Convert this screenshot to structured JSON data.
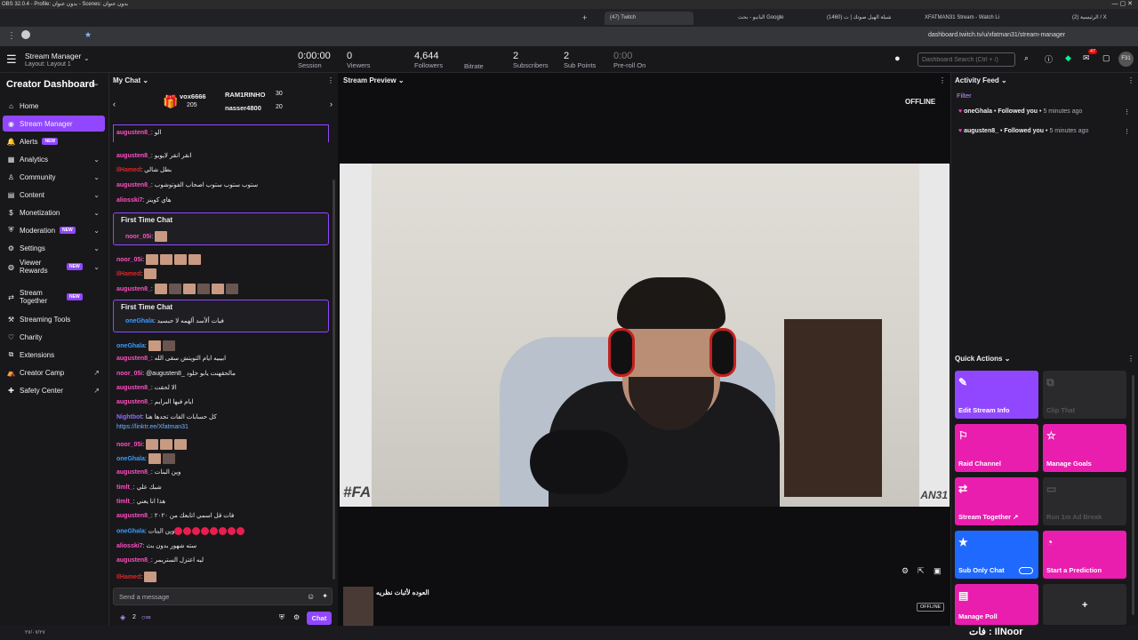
{
  "window": {
    "title": "OBS 32.0.4 - Profile: بدون عنوان - Scenes: بدون عنوان"
  },
  "browser": {
    "tabs": [
      {
        "label": "(47) Twitch"
      },
      {
        "label": "البانيو - بحث Google"
      },
      {
        "label": "(1460) شيلة الهيل صوتك | ت"
      },
      {
        "label": "XFATMAN31 Stream - Watch Li"
      },
      {
        "label": "(2) الرئيسية / X"
      }
    ],
    "url": "dashboard.twitch.tv/u/xfatman31/stream-manager"
  },
  "topbar": {
    "manager_title": "Stream Manager",
    "layout": "Layout: Layout 1",
    "stats": [
      {
        "value": "0:00:00",
        "label": "Session"
      },
      {
        "value": "0",
        "label": "Viewers"
      },
      {
        "value": "4,644",
        "label": "Followers"
      },
      {
        "value": "",
        "label": "Bitrate"
      },
      {
        "value": "2",
        "label": "Subscribers"
      },
      {
        "value": "2",
        "label": "Sub Points"
      },
      {
        "value": "0:00",
        "label": "Pre-roll On"
      }
    ],
    "search_placeholder": "Dashboard Search (Ctrl + /)",
    "notif_count": "47",
    "avatar": "F31"
  },
  "sidebar": {
    "title": "Creator Dashboard",
    "items": [
      {
        "label": "Home",
        "badge": "",
        "chevron": false
      },
      {
        "label": "Stream Manager",
        "badge": "",
        "chevron": false
      },
      {
        "label": "Alerts",
        "badge": "NEW",
        "chevron": false
      },
      {
        "label": "Analytics",
        "badge": "",
        "chevron": true
      },
      {
        "label": "Community",
        "badge": "",
        "chevron": true
      },
      {
        "label": "Content",
        "badge": "",
        "chevron": true
      },
      {
        "label": "Monetization",
        "badge": "",
        "chevron": true
      },
      {
        "label": "Moderation",
        "badge": "NEW",
        "chevron": true
      },
      {
        "label": "Settings",
        "badge": "",
        "chevron": true
      },
      {
        "label": "Viewer Rewards",
        "badge": "NEW",
        "chevron": true
      },
      {
        "label": "Stream Together",
        "badge": "NEW",
        "chevron": false
      },
      {
        "label": "Streaming Tools",
        "badge": "",
        "chevron": false
      },
      {
        "label": "Charity",
        "badge": "",
        "chevron": false
      },
      {
        "label": "Extensions",
        "badge": "",
        "chevron": false
      },
      {
        "label": "Creator Camp",
        "badge": "",
        "chevron": false
      },
      {
        "label": "Safety Center",
        "badge": "",
        "chevron": false
      }
    ]
  },
  "chat": {
    "header": "My Chat",
    "gifters": [
      {
        "name": "vox6666",
        "count": "205"
      },
      {
        "name": "RAM1RINHO",
        "count": "30"
      },
      {
        "name": "nasser4800",
        "count": "20"
      }
    ],
    "first_time_label": "First Time Chat",
    "messages": [
      {
        "user": "augusten8_",
        "text": "الو",
        "color": "#ff4fc1"
      },
      {
        "user": "augusten8_",
        "text": "انقر انقر لايوبو",
        "color": "#ff4fc1"
      },
      {
        "user": "IlHamed",
        "text": "بطل شالي",
        "color": "#e02525"
      },
      {
        "user": "augusten8_",
        "text": "ستوب ستوب ستوب اصحاب الفوتوشوب",
        "color": "#ff4fc1"
      },
      {
        "user": "aliosski7",
        "text": "هاي كوينز",
        "color": "#ff4fc1"
      },
      {
        "user": "noor_05i",
        "text": "",
        "color": "#ff4fc1"
      },
      {
        "user": "noor_05i",
        "text": "",
        "color": "#ff4fc1"
      },
      {
        "user": "IlHamed",
        "text": "",
        "color": "#e02525"
      },
      {
        "user": "augusten8_",
        "text": "",
        "color": "#ff4fc1"
      },
      {
        "user": "oneGhala",
        "text": "فيات ألأسد ألهمه لا حبسيد",
        "color": "#3b9cff"
      },
      {
        "user": "oneGhala",
        "text": "",
        "color": "#3b9cff"
      },
      {
        "user": "augusten8_",
        "text": "ابيبيه ايام التويتش سقى الله",
        "color": "#ff4fc1"
      },
      {
        "user": "noor_05i",
        "text": "@augusten8_ مالحقهنت يابو خلود",
        "color": "#ff4fc1"
      },
      {
        "user": "augusten8_",
        "text": "الا لحقت",
        "color": "#ff4fc1"
      },
      {
        "user": "augusten8_",
        "text": "ايام فيها البرايم",
        "color": "#ff4fc1"
      },
      {
        "user": "Nightbot",
        "text": "كل حسابات الفات تجدها هنا",
        "color": "#8f6cff"
      },
      {
        "user": "",
        "text": "https://linktr.ee/Xfatman31",
        "color": "#6fb3ff"
      },
      {
        "user": "noor_05i",
        "text": "",
        "color": "#ff4fc1"
      },
      {
        "user": "oneGhala",
        "text": "",
        "color": "#3b9cff"
      },
      {
        "user": "augusten8_",
        "text": "وين البنات",
        "color": "#ff4fc1"
      },
      {
        "user": "timlt_",
        "text": "شيك علي",
        "color": "#ff4fc1"
      },
      {
        "user": "timlt_",
        "text": "هذا انا يعني",
        "color": "#ff4fc1"
      },
      {
        "user": "augusten8_",
        "text": "فات قل اسمي اتابعك من ٢٠٢٠",
        "color": "#ff4fc1"
      },
      {
        "user": "oneGhala",
        "text": "وين البنات",
        "color": "#3b9cff"
      },
      {
        "user": "aliosski7",
        "text": "سته شهور بدون بث",
        "color": "#ff4fc1"
      },
      {
        "user": "augusten8_",
        "text": "ليه اعتزل الستريمر",
        "color": "#ff4fc1"
      },
      {
        "user": "IlHamed",
        "text": "",
        "color": "#e02525"
      }
    ],
    "input_placeholder": "Send a message",
    "points": "2",
    "chat_button": "Chat"
  },
  "preview": {
    "header": "Stream Preview",
    "status": "OFFLINE",
    "overlay_left": "#FA",
    "overlay_right": "AN31",
    "stream_title": "العوده لأثبات نظريه",
    "offline_badge": "OFFLINE"
  },
  "activity": {
    "header": "Activity Feed",
    "filter": "Filter",
    "items": [
      {
        "user": "oneGhala",
        "action": "Followed you",
        "time": "5 minutes ago"
      },
      {
        "user": "augusten8_",
        "action": "Followed you",
        "time": "5 minutes ago"
      }
    ]
  },
  "quick_actions": {
    "header": "Quick Actions",
    "items": [
      {
        "label": "Edit Stream Info",
        "color": "#9147ff"
      },
      {
        "label": "Clip That",
        "color": "#2a2a2d"
      },
      {
        "label": "Raid Channel",
        "color": "#e91eae"
      },
      {
        "label": "Manage Goals",
        "color": "#e91eae"
      },
      {
        "label": "Stream Together ↗",
        "color": "#e91eae"
      },
      {
        "label": "Run 1m Ad Break",
        "color": "#2a2a2d"
      },
      {
        "label": "Sub Only Chat",
        "color": "#1f69ff"
      },
      {
        "label": "Start a Prediction",
        "color": "#e91eae"
      },
      {
        "label": "Manage Poll",
        "color": "#e91eae"
      },
      {
        "label": "+",
        "color": "#2a2a2d"
      }
    ]
  },
  "taskbar": {
    "date": "٢٧/٠٧/٢٧",
    "overlay_text": "فات : IlNoor"
  }
}
